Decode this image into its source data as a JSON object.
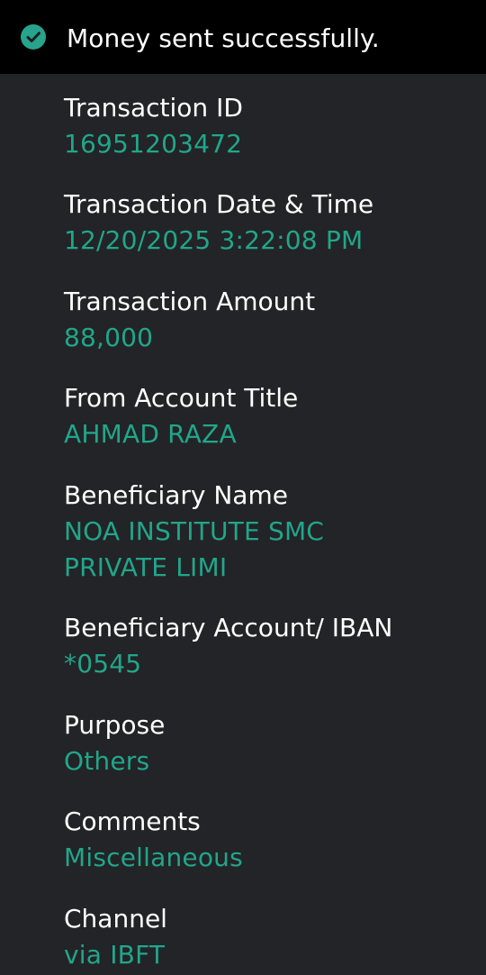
{
  "toast": {
    "icon": "check-circle-icon",
    "message": "Money sent successfully.",
    "accent": "#27a48b"
  },
  "details": [
    {
      "label": "Transaction ID",
      "value": "16951203472"
    },
    {
      "label": "Transaction Date & Time",
      "value": "12/20/2025 3:22:08 PM"
    },
    {
      "label": "Transaction Amount",
      "value": "88,000"
    },
    {
      "label": "From Account Title",
      "value": "AHMAD RAZA"
    },
    {
      "label": "Beneficiary Name",
      "value": "NOA INSTITUTE SMC\nPRIVATE LIMI"
    },
    {
      "label": "Beneficiary Account/ IBAN",
      "value": "*0545"
    },
    {
      "label": "Purpose",
      "value": "Others"
    },
    {
      "label": "Comments",
      "value": "Miscellaneous"
    },
    {
      "label": "Channel",
      "value": "via IBFT"
    }
  ],
  "colors": {
    "background": "#232427",
    "topbar": "#000000",
    "value_text": "#21a68b",
    "label_text": "#ffffff"
  }
}
